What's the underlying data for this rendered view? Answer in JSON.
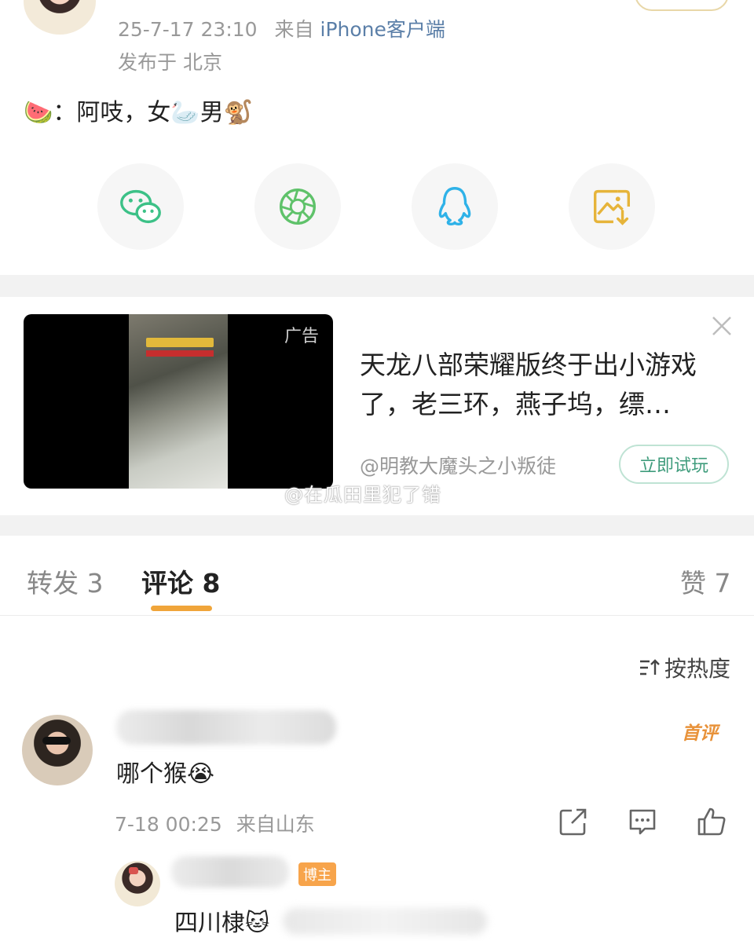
{
  "post": {
    "timestamp": "25-7-17 23:10",
    "source_prefix": "来自",
    "source": "iPhone客户端",
    "location": "发布于 北京",
    "text_body": "：阿吱，女",
    "text_male": "男",
    "emoji_watermelon": "🍉",
    "emoji_swan": "🦢",
    "emoji_monkey": "🐒"
  },
  "share": [
    {
      "name": "wechat-icon",
      "color": "#3cc187"
    },
    {
      "name": "moments-icon",
      "color": "#5fc26a"
    },
    {
      "name": "qq-icon",
      "color": "#2fb2e8"
    },
    {
      "name": "save-image-icon",
      "color": "#e6b43a"
    }
  ],
  "ad": {
    "tag": "广告",
    "title": "天龙八部荣耀版终于出小游戏了，老三环，燕子坞，缥…",
    "author": "@明教大魔头之小叛徒",
    "cta": "立即试玩",
    "watermark": "@在瓜田里犯了错"
  },
  "tabs": [
    {
      "label": "转发 3",
      "active": false
    },
    {
      "label": "评论 8",
      "active": true
    },
    {
      "label": "赞 7",
      "active": false
    }
  ],
  "sort_label": "按热度",
  "comment": {
    "first_tag": "首评",
    "text": "哪个猴",
    "emoji": "😭",
    "time": "7-18 00:25",
    "from": "来自山东"
  },
  "reply": {
    "badge": "博主",
    "text": "四川棣",
    "emoji": "🐱"
  },
  "colors": {
    "accent_orange": "#f0a53a",
    "link_blue": "#5b7fa8",
    "cta_green": "#3f9c7c"
  }
}
